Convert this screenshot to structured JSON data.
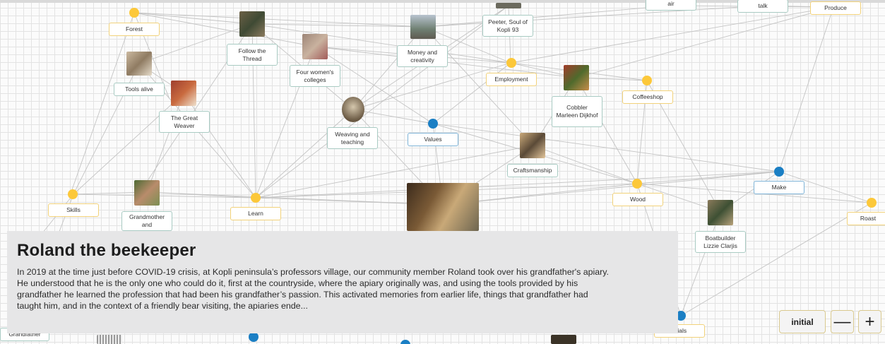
{
  "graph": {
    "nodes": [
      {
        "id": "forest",
        "label": "Forest",
        "kind": "topic"
      },
      {
        "id": "tools-alive",
        "label": "Tools alive",
        "kind": "story"
      },
      {
        "id": "follow-thread",
        "label": "Follow the Thread",
        "kind": "story"
      },
      {
        "id": "four-womens",
        "label": "Four women's colleges",
        "kind": "story"
      },
      {
        "id": "great-weaver",
        "label": "The Great Weaver",
        "kind": "story"
      },
      {
        "id": "weaving-teaching",
        "label": "Weaving and teaching",
        "kind": "story"
      },
      {
        "id": "money-creativity",
        "label": "Money and creativity",
        "kind": "story"
      },
      {
        "id": "peeter",
        "label": "Peeter, Soul of Kopli 93",
        "kind": "story"
      },
      {
        "id": "values",
        "label": "Values",
        "kind": "value"
      },
      {
        "id": "employment",
        "label": "Employment",
        "kind": "topic"
      },
      {
        "id": "cobbler",
        "label": "Cobbler Marleen Dijkhof",
        "kind": "story"
      },
      {
        "id": "coffeeshop",
        "label": "Coffeeshop",
        "kind": "topic"
      },
      {
        "id": "craftsmanship",
        "label": "Craftsmanship",
        "kind": "story"
      },
      {
        "id": "skills",
        "label": "Skills",
        "kind": "topic"
      },
      {
        "id": "grandmother",
        "label": "Grandmother and",
        "kind": "story"
      },
      {
        "id": "learn",
        "label": "Learn",
        "kind": "topic"
      },
      {
        "id": "wood",
        "label": "Wood",
        "kind": "topic"
      },
      {
        "id": "make",
        "label": "Make",
        "kind": "value"
      },
      {
        "id": "boatbuilder",
        "label": "Boatbuilder Lizzie Clarjis",
        "kind": "story"
      },
      {
        "id": "roast",
        "label": "Roast",
        "kind": "topic"
      },
      {
        "id": "air",
        "label": "air",
        "kind": "story"
      },
      {
        "id": "talk",
        "label": "talk",
        "kind": "story"
      },
      {
        "id": "produce",
        "label": "Produce",
        "kind": "topic"
      },
      {
        "id": "grandfather",
        "label": "Grandfather",
        "kind": "story"
      },
      {
        "id": "materials",
        "label": "erials",
        "kind": "topic"
      }
    ]
  },
  "story": {
    "title": "Roland the beekeeper",
    "body": "In 2019 at the time just before COVID-19 crisis, at Kopli peninsula’s professors village, our community member Roland took over his grandfather's apiary. He understood that he is the only one who could do it, first at the countryside, where the apiary originally was, and using the tools provided by his grandfather he learned the profession that had been his grandfather’s passion. This activated memories from earlier life, things that grandfather had taught him, and in the context of a friendly bear visiting, the apiaries ende..."
  },
  "controls": {
    "initial_label": "initial",
    "zoom_out_label": "—",
    "zoom_in_label": "+"
  },
  "colors": {
    "topic_dot": "#fcc83a",
    "value_dot": "#1b7fc4",
    "story_border": "#a9cbc3",
    "panel_bg": "#e6e6e7"
  }
}
